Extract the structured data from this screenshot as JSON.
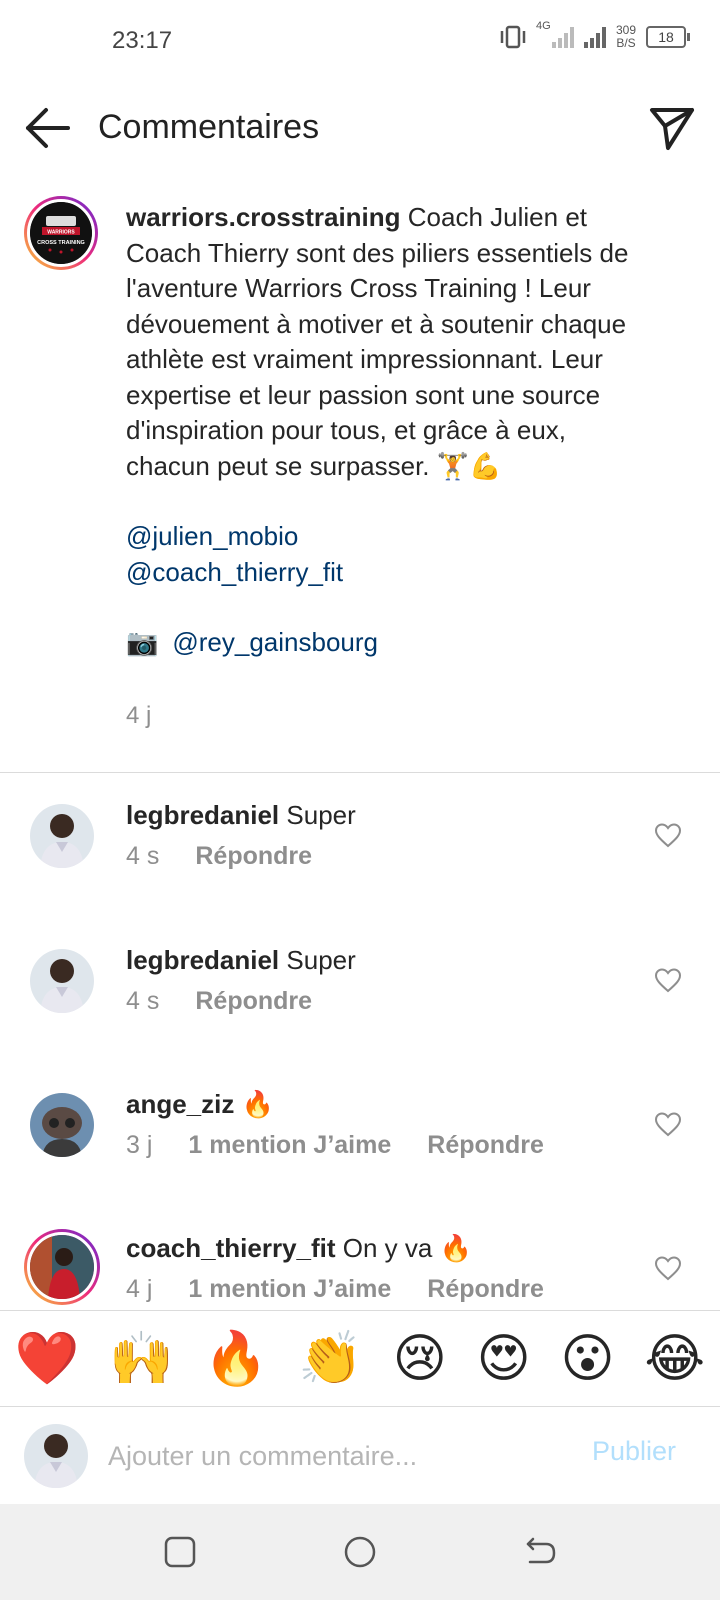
{
  "status_bar": {
    "time": "23:17",
    "network": "4G",
    "speed_top": "309",
    "speed_bottom": "B/S",
    "battery": "18"
  },
  "header": {
    "title": "Commentaires",
    "back_icon": "arrow-left-icon",
    "send_icon": "paper-plane-icon"
  },
  "post": {
    "username": "warriors.crosstraining",
    "caption": "Coach Julien et Coach Thierry sont des piliers essentiels de l'aventure Warriors Cross Training ! Leur dévouement à motiver et à soutenir chaque athlète est vraiment impressionnant. Leur expertise et leur passion sont une source d'inspiration pour tous, et grâce à eux, chacun peut se surpasser. 🏋️💪",
    "mention_1": "@julien_mobio",
    "mention_2": "@coach_thierry_fit",
    "camera_emoji": "📷",
    "photo_credit": "@rey_gainsbourg",
    "time": "4 j",
    "avatar_text_1": "WARRIORS",
    "avatar_text_2": "CROSS TRAINING"
  },
  "comments": [
    {
      "username": "legbredaniel",
      "text": "Super",
      "time": "4 s",
      "likes": "",
      "reply": "Répondre"
    },
    {
      "username": "legbredaniel",
      "text": "Super",
      "time": "4 s",
      "likes": "",
      "reply": "Répondre"
    },
    {
      "username": "ange_ziz",
      "text": "🔥",
      "time": "3 j",
      "likes": "1 mention J’aime",
      "reply": "Répondre"
    },
    {
      "username": "coach_thierry_fit",
      "text": "On y va 🔥",
      "time": "4 j",
      "likes": "1 mention J’aime",
      "reply": "Répondre"
    }
  ],
  "emoji_bar": [
    "❤️",
    "🙌",
    "🔥",
    "👏",
    "😢",
    "😍",
    "😮",
    "😂"
  ],
  "compose": {
    "placeholder": "Ajouter un commentaire...",
    "publish": "Publier"
  },
  "colors": {
    "mention": "#00376b",
    "secondary_text": "#8e8e8e",
    "publish_disabled": "#b2dffc"
  }
}
